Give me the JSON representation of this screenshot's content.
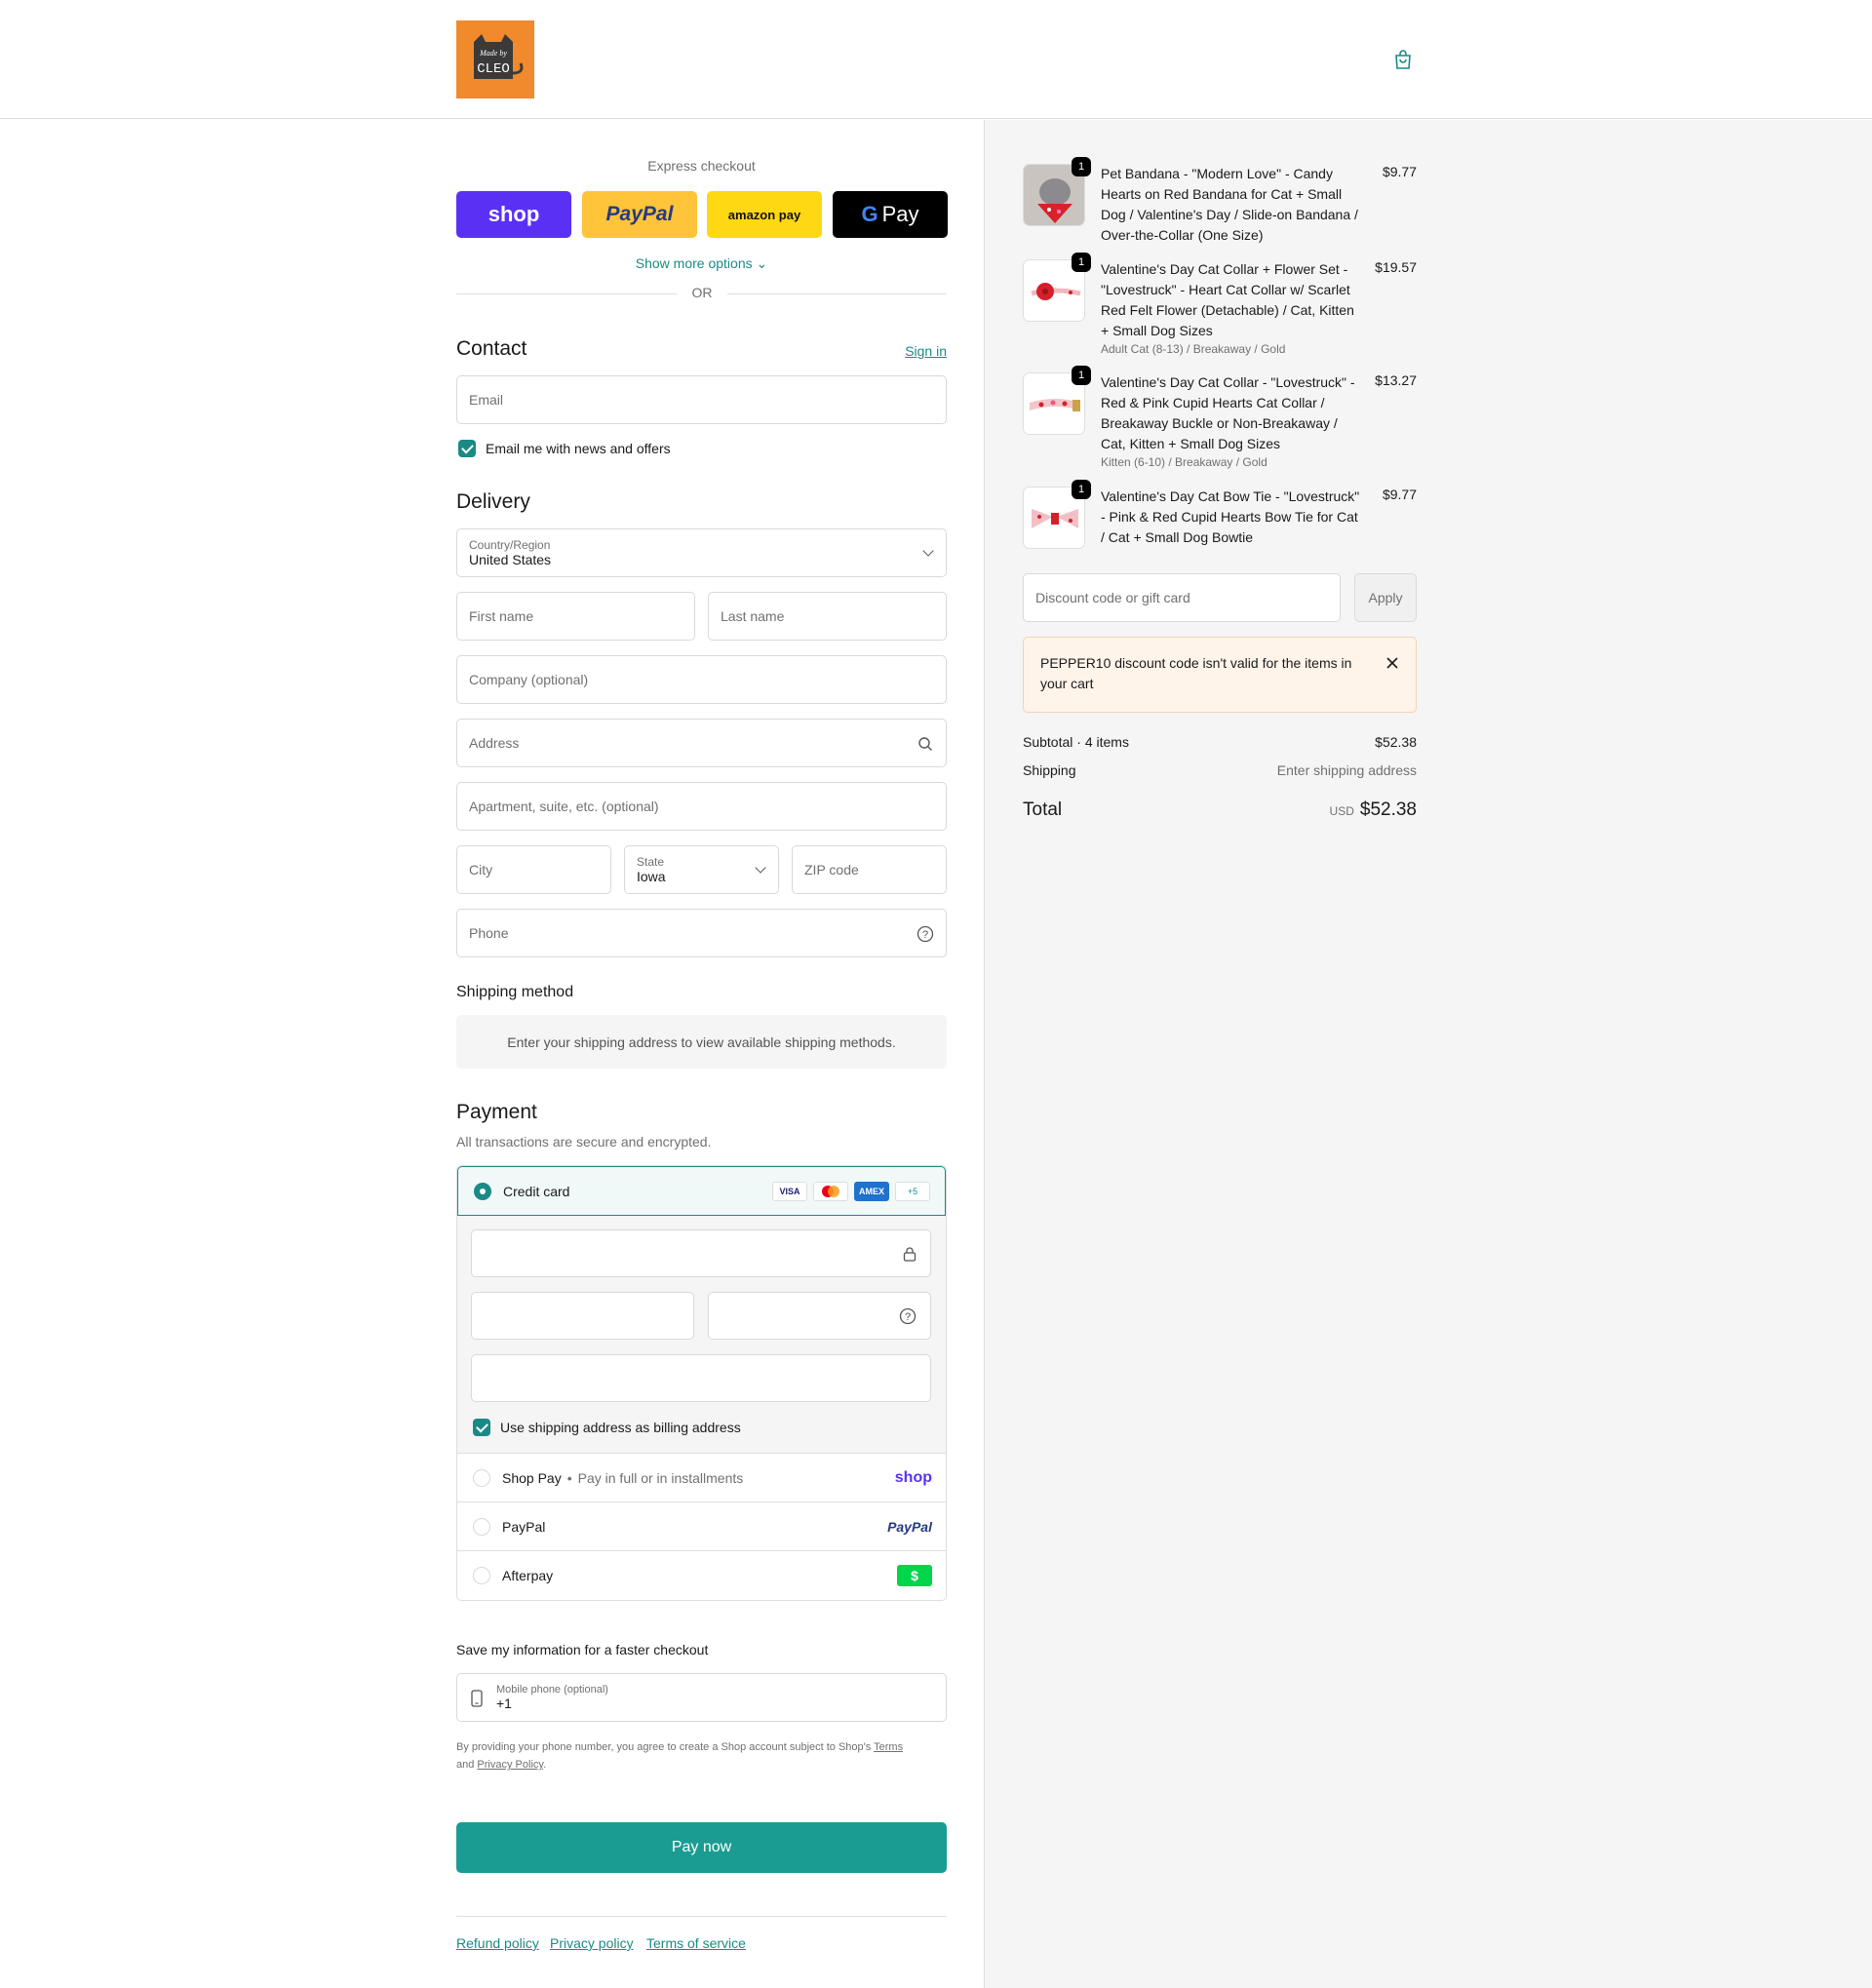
{
  "header": {
    "logo_text": "Made by CLEO",
    "bag_icon": "shopping-bag-icon"
  },
  "express": {
    "title": "Express checkout",
    "shop_label": "shop",
    "paypal_label": "PayPal",
    "amazon_label": "amazon pay",
    "gpay_label": "Pay",
    "more": "Show more options",
    "or": "OR"
  },
  "contact": {
    "title": "Contact",
    "sign_in": "Sign in",
    "email_placeholder": "Email",
    "news": "Email me with news and offers"
  },
  "delivery": {
    "title": "Delivery",
    "country_label": "Country/Region",
    "country_value": "United States",
    "first": "First name",
    "last": "Last name",
    "company": "Company (optional)",
    "address": "Address",
    "apt": "Apartment, suite, etc. (optional)",
    "city": "City",
    "state_label": "State",
    "state_value": "Iowa",
    "zip": "ZIP code",
    "phone": "Phone"
  },
  "shipping": {
    "title": "Shipping method",
    "note": "Enter your shipping address to view available shipping methods."
  },
  "payment": {
    "title": "Payment",
    "subtitle": "All transactions are secure and encrypted.",
    "credit": "Credit card",
    "visa": "VISA",
    "amex": "AMEX",
    "more_cards": "+5",
    "billing": "Use shipping address as billing address",
    "shoppay": "Shop Pay",
    "shoppay_note": "Pay in full or in installments",
    "shoppay_logo": "shop",
    "paypal": "PayPal",
    "paypal_logo": "PayPal",
    "afterpay": "Afterpay",
    "afterpay_logo": "$"
  },
  "save": {
    "title": "Save my information for a faster checkout",
    "mobile_label": "Mobile phone (optional)",
    "mobile_value": "+1",
    "legal_pre": "By providing your phone number, you agree to create a Shop account subject to Shop's",
    "terms": "Terms",
    "and": "and",
    "privacy": "Privacy Policy",
    "period": "."
  },
  "pay_now": "Pay now",
  "footer": {
    "refund": "Refund policy",
    "privacy": "Privacy policy",
    "terms": "Terms of service"
  },
  "cart": {
    "items": [
      {
        "qty": "1",
        "name": "Pet Bandana - \"Modern Love\" - Candy Hearts on Red Bandana for Cat + Small Dog / Valentine's Day / Slide-on Bandana / Over-the-Collar (One Size)",
        "variant": "",
        "price": "$9.77"
      },
      {
        "qty": "1",
        "name": "Valentine's Day Cat Collar + Flower Set - \"Lovestruck\" - Heart Cat Collar w/ Scarlet Red Felt Flower (Detachable) / Cat, Kitten + Small Dog Sizes",
        "variant": "Adult Cat (8-13) / Breakaway / Gold",
        "price": "$19.57"
      },
      {
        "qty": "1",
        "name": "Valentine's Day Cat Collar - \"Lovestruck\" - Red & Pink Cupid Hearts Cat Collar / Breakaway Buckle or Non-Breakaway / Cat, Kitten + Small Dog Sizes",
        "variant": "Kitten (6-10) / Breakaway / Gold",
        "price": "$13.27"
      },
      {
        "qty": "1",
        "name": "Valentine's Day Cat Bow Tie - \"Lovestruck\" - Pink & Red Cupid Hearts Bow Tie for Cat / Cat + Small Dog Bowtie",
        "variant": "",
        "price": "$9.77"
      }
    ],
    "discount_placeholder": "Discount code or gift card",
    "apply": "Apply",
    "error": "PEPPER10 discount code isn't valid for the items in your cart",
    "subtotal_label": "Subtotal · 4 items",
    "subtotal": "$52.38",
    "shipping_label": "Shipping",
    "shipping_value": "Enter shipping address",
    "total_label": "Total",
    "currency": "USD",
    "total": "$52.38"
  }
}
